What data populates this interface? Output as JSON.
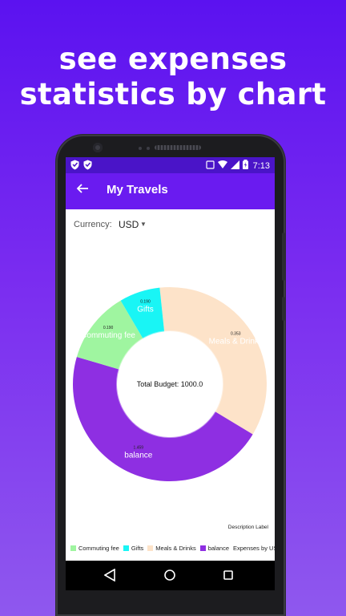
{
  "headline": {
    "line1": "see expenses",
    "line2": "statistics by chart"
  },
  "status_bar": {
    "time": "7:13"
  },
  "app_bar": {
    "title": "My Travels"
  },
  "currency": {
    "label": "Currency:",
    "value": "USD"
  },
  "chart_data": {
    "type": "pie",
    "center_text": "Total Budget: 1000.0",
    "description_label": "Description Label",
    "legend_title": "Expenses by USD",
    "slices": [
      {
        "name": "Meals & Drinks",
        "value": 0.353,
        "value_label": "0.353",
        "color": "#fde3c9"
      },
      {
        "name": "balance",
        "value": 0.459,
        "value_label": "1.459",
        "color": "#8e2fe2"
      },
      {
        "name": "Commuting fee",
        "value": 0.12,
        "value_label": "0.190",
        "color": "#9ff5a0"
      },
      {
        "name": "Gifts",
        "value": 0.068,
        "value_label": "0.190",
        "color": "#19f5f5"
      }
    ],
    "legend_order": [
      "Commuting fee",
      "Gifts",
      "Meals & Drinks",
      "balance"
    ]
  },
  "colors": {
    "primary": "#6a1bf0",
    "status_bar": "#4a14c8",
    "background": "#5b12f0"
  }
}
